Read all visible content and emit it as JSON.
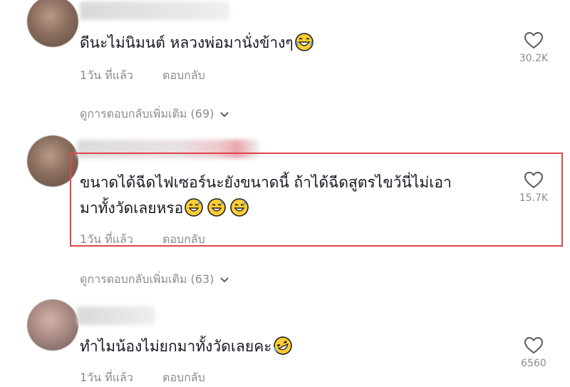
{
  "comments": [
    {
      "text": "ดีนะไม่นิมนต์ หลวงพ่อมานั่งข้างๆ",
      "emoji": "laughing-emoji",
      "time": "1วัน ที่แล้ว",
      "reply_label": "ตอบกลับ",
      "likes": "30.2K"
    },
    {
      "line1": "ขนาดได้ฉีดไฟเซอร์นะยังขนาดนี้ ถ้าได้ฉีดสูตรไขว้นี่ไม่เอา",
      "line2": "มาทั้งวัดเลยหรอ",
      "emoji": "sweat-smile-emoji",
      "time": "1วัน ที่แล้ว",
      "reply_label": "ตอบกลับ",
      "likes": "15.7K"
    },
    {
      "text": "ทำไมน้องไม่ยกมาทั้งวัดเลยคะ",
      "emoji": "rofl-emoji",
      "time": "1วัน ที่แล้ว",
      "reply_label": "ตอบกลับ",
      "likes": "6560"
    }
  ],
  "more_replies": [
    {
      "label": "ดูการตอบกลับเพิ่มเติม (69)"
    },
    {
      "label": "ดูการตอบกลับเพิ่มเติม (63)"
    }
  ],
  "colors": {
    "text": "#161823",
    "meta": "#8a8b91",
    "highlight": "#e0474c"
  }
}
